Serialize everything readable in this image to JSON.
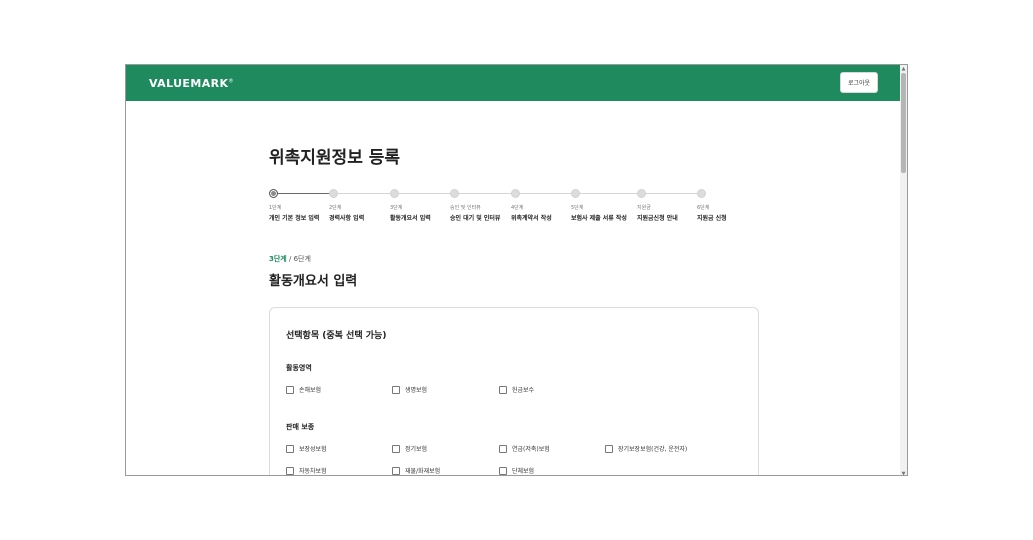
{
  "header": {
    "logo": "VALUEMARK",
    "logo_mark": "®",
    "logout_label": "로그아웃",
    "brand_color": "#1e8a5e"
  },
  "page": {
    "title": "위촉지원정보 등록"
  },
  "stepper": {
    "steps": [
      {
        "num": "1단계",
        "label": "개인 기본 정보 입력",
        "state": "current"
      },
      {
        "num": "2단계",
        "label": "경력사항 입력",
        "state": "pending"
      },
      {
        "num": "3단계",
        "label": "활동개요서 입력",
        "state": "pending"
      },
      {
        "num": "승인 및 인터뷰",
        "label": "승인 대기 및 인터뷰",
        "state": "pending"
      },
      {
        "num": "4단계",
        "label": "위촉계약서 작성",
        "state": "pending"
      },
      {
        "num": "5단계",
        "label": "보험사 제출 서류 작성",
        "state": "pending"
      },
      {
        "num": "지원금",
        "label": "지원금신청 안내",
        "state": "pending"
      },
      {
        "num": "6단계",
        "label": "지원금 신청",
        "state": "pending"
      }
    ]
  },
  "progress": {
    "current": "3단계",
    "separator": " / ",
    "total": "6단계"
  },
  "section": {
    "title": "활동개요서 입력"
  },
  "card": {
    "title": "선택항목 (중복 선택 가능)",
    "groups": [
      {
        "title": "활동영역",
        "options": [
          "손해보험",
          "생명보험",
          "헌금보수"
        ]
      },
      {
        "title": "판매 보종",
        "options": [
          "보장성보험",
          "정기보험",
          "연금(저축)보험",
          "장기보장보험(건강, 운전자)",
          "자동차보험",
          "재물/화재보험",
          "단체보험"
        ]
      }
    ]
  }
}
